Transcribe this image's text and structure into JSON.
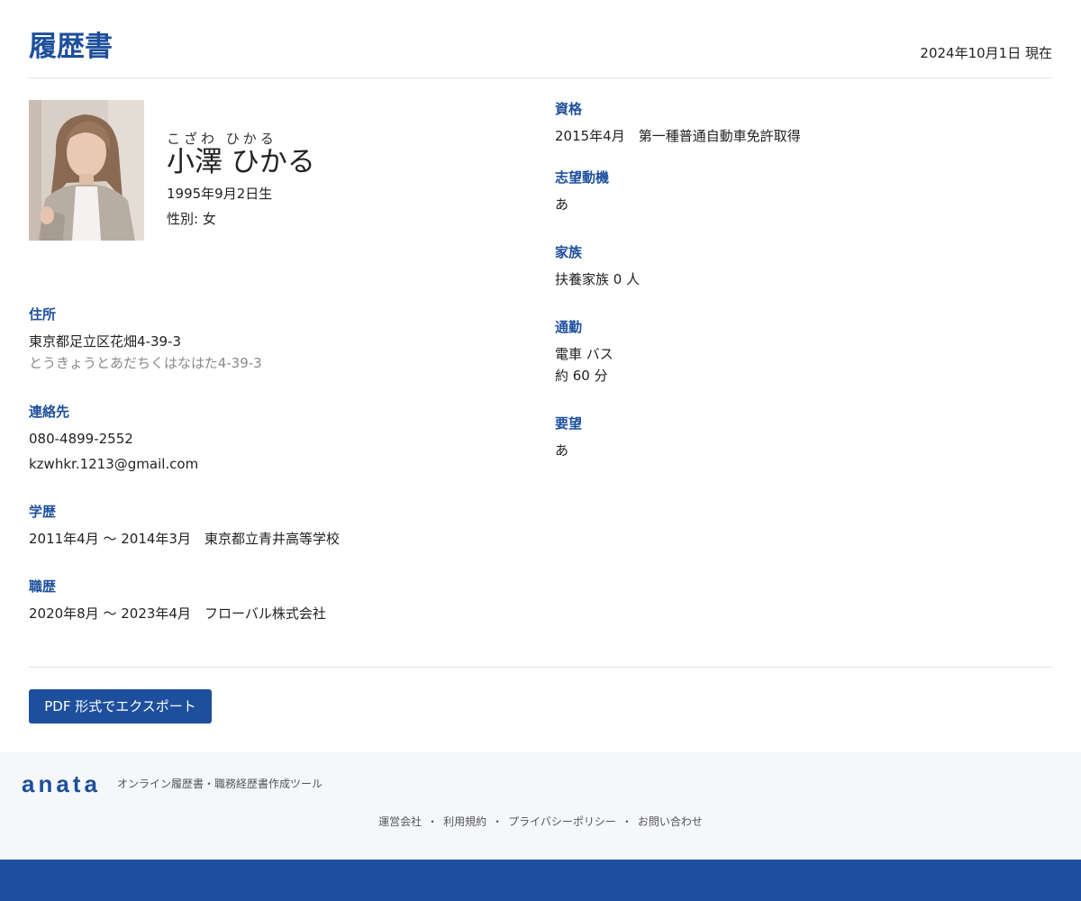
{
  "header": {
    "title": "履歴書",
    "as_of_date": "2024年10月1日 現在"
  },
  "profile": {
    "furigana": "こざわ ひかる",
    "name": "小澤 ひかる",
    "birth": "1995年9月2日生",
    "gender": "性別: 女"
  },
  "address": {
    "label": "住所",
    "value": "東京都足立区花畑4-39-3",
    "kana": "とうきょうとあだちくはなはた4-39-3"
  },
  "contact": {
    "label": "連絡先",
    "phone": "080-4899-2552",
    "email": "kzwhkr.1213@gmail.com"
  },
  "education": {
    "label": "学歴",
    "entries": [
      "2011年4月 〜 2014年3月　東京都立青井高等学校"
    ]
  },
  "work": {
    "label": "職歴",
    "entries": [
      "2020年8月 〜 2023年4月　フローバル株式会社"
    ]
  },
  "qualifications": {
    "label": "資格",
    "entries": [
      "2015年4月　第一種普通自動車免許取得"
    ]
  },
  "motivation": {
    "label": "志望動機",
    "value": "あ"
  },
  "family": {
    "label": "家族",
    "value": "扶養家族 0 人"
  },
  "commute": {
    "label": "通勤",
    "method": "電車 バス",
    "time": "約 60 分"
  },
  "requests": {
    "label": "要望",
    "value": "あ"
  },
  "actions": {
    "export_label": "PDF 形式でエクスポート"
  },
  "footer": {
    "brand": "anata",
    "tagline": "オンライン履歴書・職務経歴書作成ツール",
    "links": [
      "運営会社",
      "利用規約",
      "プライバシーポリシー",
      "お問い合わせ"
    ],
    "separator": "・"
  },
  "colors": {
    "accent": "#1d4f9c",
    "footer_bg": "#f5f7fa",
    "bottom_bar": "#1d4fa0"
  }
}
